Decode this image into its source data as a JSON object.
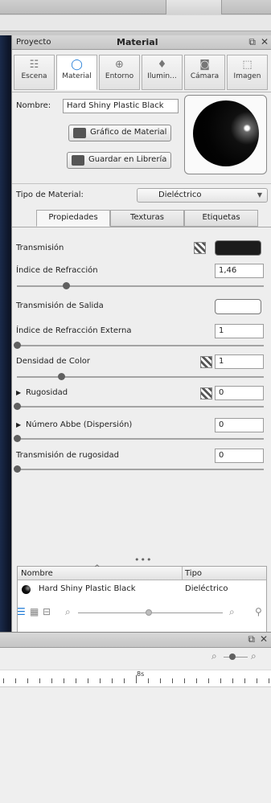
{
  "panel": {
    "left_title": "Proyecto",
    "title": "Material"
  },
  "tabs": [
    {
      "label": "Escena",
      "icon": "scene-icon"
    },
    {
      "label": "Material",
      "icon": "material-icon"
    },
    {
      "label": "Entorno",
      "icon": "environment-icon"
    },
    {
      "label": "Ilumin...",
      "icon": "lighting-icon"
    },
    {
      "label": "Cámara",
      "icon": "camera-icon"
    },
    {
      "label": "Imagen",
      "icon": "image-icon"
    }
  ],
  "material": {
    "name_label": "Nombre:",
    "name_value": "Hard Shiny Plastic Black",
    "graph_button": "Gráfico de Material",
    "save_button": "Guardar en Librería",
    "type_label": "Tipo de Material:",
    "type_value": "Dieléctrico"
  },
  "subtabs": [
    "Propiedades",
    "Texturas",
    "Etiquetas"
  ],
  "properties": {
    "transmision": "Transmisión",
    "refraction_index": "Índice de Refracción",
    "refraction_index_value": "1,46",
    "exit_transmission": "Transmisión de Salida",
    "external_refraction": "Índice de Refracción Externa",
    "external_refraction_value": "1",
    "color_density": "Densidad de Color",
    "color_density_value": "1",
    "roughness": "Rugosidad",
    "roughness_value": "0",
    "abbe": "Número Abbe (Dispersión)",
    "abbe_value": "0",
    "roughness_transmission": "Transmisión de rugosidad",
    "roughness_transmission_value": "0"
  },
  "slider_levels": {
    "refraction_index": 0.2,
    "external_refraction": 0.0,
    "color_density": 0.18,
    "roughness": 0.0,
    "abbe": 0.0,
    "roughness_transmission": 0.0
  },
  "list": {
    "col_name": "Nombre",
    "col_type": "Tipo",
    "rows": [
      {
        "name": "Hard Shiny Plastic Black",
        "type": "Dieléctrico"
      }
    ]
  },
  "timeline": {
    "ruler_label": "8s"
  },
  "colors": {
    "accent": "#1a78d6",
    "transmission_swatch": "#1c1c1c",
    "exit_swatch": "#ffffff"
  }
}
